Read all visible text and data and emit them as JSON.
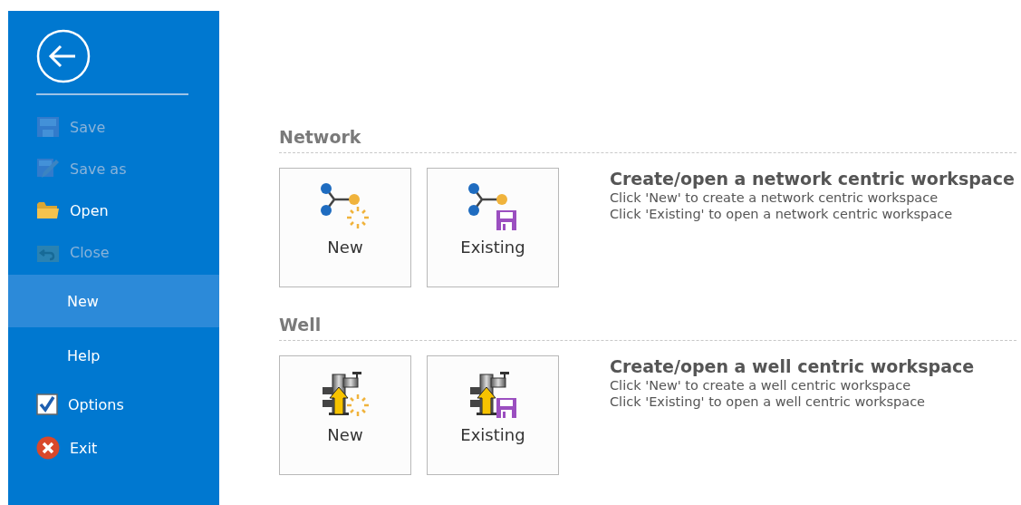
{
  "sidebar": {
    "items": [
      {
        "kind": "save",
        "label": "Save",
        "disabled": true,
        "selected": false
      },
      {
        "kind": "saveas",
        "label": "Save as",
        "disabled": true,
        "selected": false
      },
      {
        "kind": "open",
        "label": "Open",
        "disabled": false,
        "selected": false
      },
      {
        "kind": "close",
        "label": "Close",
        "disabled": true,
        "selected": false
      },
      {
        "kind": "plain",
        "label": "New",
        "disabled": false,
        "selected": true
      },
      {
        "kind": "plain",
        "label": "Help",
        "disabled": false,
        "selected": false
      },
      {
        "kind": "options",
        "label": "Options",
        "disabled": false,
        "selected": false
      },
      {
        "kind": "exit",
        "label": "Exit",
        "disabled": false,
        "selected": false
      }
    ]
  },
  "sections": [
    {
      "kind": "network",
      "heading": "Network",
      "tiles": [
        {
          "kind": "new",
          "label": "New"
        },
        {
          "kind": "existing",
          "label": "Existing"
        }
      ],
      "title": "Create/open a network centric workspace",
      "lines": [
        "Click 'New' to create a network centric workspace",
        "Click 'Existing' to open a network centric workspace"
      ]
    },
    {
      "kind": "well",
      "heading": "Well",
      "tiles": [
        {
          "kind": "new",
          "label": "New"
        },
        {
          "kind": "existing",
          "label": "Existing"
        }
      ],
      "title": "Create/open a well centric workspace",
      "lines": [
        "Click 'New' to create a well centric workspace",
        "Click 'Existing' to open a well centric workspace"
      ]
    }
  ]
}
